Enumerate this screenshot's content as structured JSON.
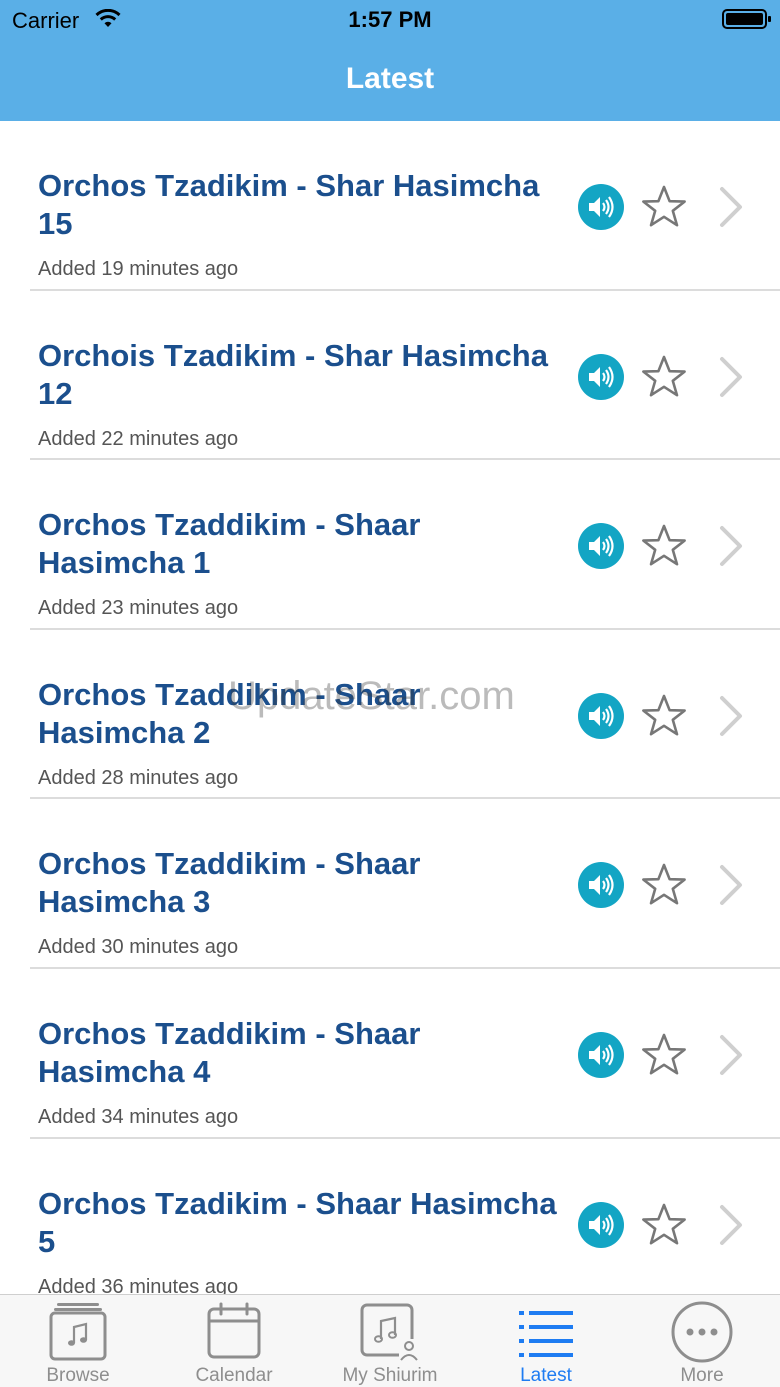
{
  "status_bar": {
    "carrier": "Carrier",
    "time": "1:57 PM"
  },
  "nav": {
    "title": "Latest"
  },
  "items": [
    {
      "title": "Orchos Tzadikim - Shar Hasimcha 15",
      "subtitle": "Added 19 minutes ago"
    },
    {
      "title": "Orchois Tzadikim - Shar Hasimcha 12",
      "subtitle": "Added 22 minutes ago"
    },
    {
      "title": "Orchos Tzaddikim - Shaar Hasimcha 1",
      "subtitle": "Added 23 minutes ago"
    },
    {
      "title": "Orchos Tzaddikim - Shaar Hasimcha 2",
      "subtitle": "Added 28 minutes ago"
    },
    {
      "title": "Orchos Tzaddikim - Shaar Hasimcha 3",
      "subtitle": "Added 30 minutes ago"
    },
    {
      "title": "Orchos Tzaddikim - Shaar Hasimcha 4",
      "subtitle": "Added 34 minutes ago"
    },
    {
      "title": "Orchos Tzadikim - Shaar Hasimcha 5",
      "subtitle": "Added 36 minutes ago"
    }
  ],
  "item_icons": {
    "audio": "speaker-icon",
    "favorite": "star-icon",
    "disclosure": "chevron-right-icon"
  },
  "watermark": "UpdateStar.com",
  "tabs": [
    {
      "label": "Browse",
      "icon": "music-library-icon",
      "active": false
    },
    {
      "label": "Calendar",
      "icon": "calendar-icon",
      "active": false
    },
    {
      "label": "My Shiurim",
      "icon": "music-person-icon",
      "active": false
    },
    {
      "label": "Latest",
      "icon": "list-icon",
      "active": true
    },
    {
      "label": "More",
      "icon": "more-icon",
      "active": false
    }
  ],
  "colors": {
    "header": "#5aafe7",
    "title_text": "#1b4f8d",
    "audio_button": "#13a5c4",
    "active_tab": "#1e7cf2",
    "inactive_tab": "#8e8e8e"
  }
}
